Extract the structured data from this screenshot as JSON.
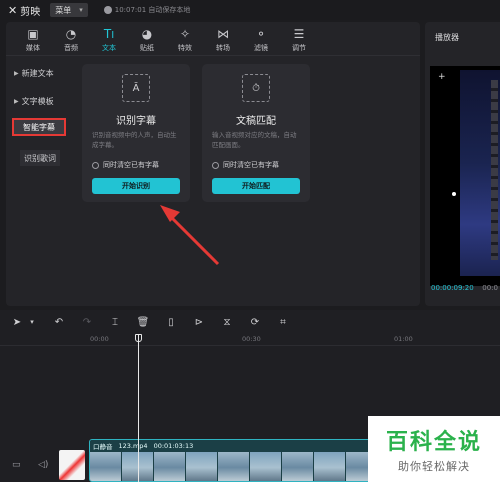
{
  "titlebar": {
    "app_name": "剪映",
    "menu_label": "菜单",
    "save_status": "10:07:01 自动保存本地"
  },
  "tabs": [
    {
      "label": "媒体",
      "icon": "media-icon"
    },
    {
      "label": "音频",
      "icon": "audio-icon"
    },
    {
      "label": "文本",
      "icon": "text-icon",
      "active": true
    },
    {
      "label": "贴纸",
      "icon": "sticker-icon"
    },
    {
      "label": "特效",
      "icon": "effects-icon"
    },
    {
      "label": "转场",
      "icon": "transition-icon"
    },
    {
      "label": "滤镜",
      "icon": "filter-icon"
    },
    {
      "label": "调节",
      "icon": "adjust-icon"
    }
  ],
  "sidebar": {
    "items": [
      {
        "label": "新建文本"
      },
      {
        "label": "文字模板"
      },
      {
        "label": "智能字幕",
        "selected": true
      },
      {
        "label": "识别歌词"
      }
    ]
  },
  "cards": [
    {
      "title": "识别字幕",
      "description": "识别音视频中的人声，自动生成字幕。",
      "checkbox": "同时清空已有字幕",
      "button": "开始识别"
    },
    {
      "title": "文稿匹配",
      "description": "输入音视频对应的文稿，自动匹配画面。",
      "checkbox": "同时清空已有字幕",
      "button": "开始匹配"
    }
  ],
  "player": {
    "title": "播放器",
    "current_time": "00:00:09:20",
    "total_time": "00:0"
  },
  "timeline": {
    "ruler": [
      "00:00",
      "00:30",
      "01:00"
    ],
    "clip": {
      "name": "口静音",
      "file": "123.mp4",
      "duration": "00:01:03:13"
    }
  },
  "watermark": {
    "main": "百科全说",
    "sub": "助你轻松解决"
  },
  "colors": {
    "accent": "#22c3d3",
    "highlight_border": "#e53935",
    "arrow": "#e53935"
  }
}
